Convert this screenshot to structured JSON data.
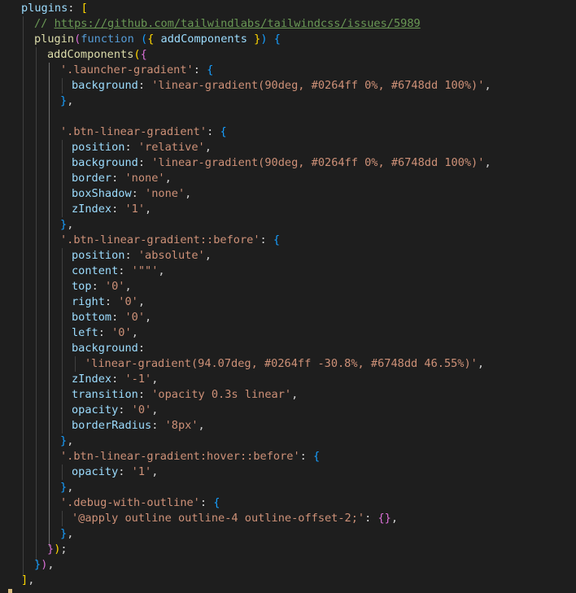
{
  "editor": {
    "theme": {
      "background": "#1e1e1e",
      "property": "#9cdcfe",
      "string": "#ce9178",
      "function": "#dcdcaa",
      "keyword": "#569cd6",
      "comment": "#6a9955",
      "punctuation": "#d4d4d4",
      "bracket_gold": "#ffd700",
      "bracket_purple": "#da70d6",
      "bracket_blue": "#179fff"
    },
    "lines": [
      [
        [
          "p",
          "plugins"
        ],
        [
          "d",
          ": "
        ],
        [
          "g",
          "["
        ]
      ],
      [
        [
          "c",
          "// "
        ],
        [
          "u",
          "https://github.com/tailwindlabs/tailwindcss/issues/5989"
        ]
      ],
      [
        [
          "f",
          "plugin"
        ],
        [
          "r",
          "("
        ],
        [
          "k",
          "function"
        ],
        [
          "d",
          " "
        ],
        [
          "b",
          "("
        ],
        [
          "g",
          "{"
        ],
        [
          "d",
          " "
        ],
        [
          "p",
          "addComponents"
        ],
        [
          "d",
          " "
        ],
        [
          "g",
          "}"
        ],
        [
          "b",
          ")"
        ],
        [
          "d",
          " "
        ],
        [
          "b",
          "{"
        ]
      ],
      [
        [
          "f",
          "addComponents"
        ],
        [
          "g",
          "("
        ],
        [
          "r",
          "{"
        ]
      ],
      [
        [
          "s",
          "'.launcher-gradient'"
        ],
        [
          "d",
          ": "
        ],
        [
          "b",
          "{"
        ]
      ],
      [
        [
          "p",
          "background"
        ],
        [
          "d",
          ": "
        ],
        [
          "s",
          "'linear-gradient(90deg, #0264ff 0%, #6748dd 100%)'"
        ],
        [
          "d",
          ","
        ]
      ],
      [
        [
          "b",
          "}"
        ],
        [
          "d",
          ","
        ]
      ],
      [],
      [
        [
          "s",
          "'.btn-linear-gradient'"
        ],
        [
          "d",
          ": "
        ],
        [
          "b",
          "{"
        ]
      ],
      [
        [
          "p",
          "position"
        ],
        [
          "d",
          ": "
        ],
        [
          "s",
          "'relative'"
        ],
        [
          "d",
          ","
        ]
      ],
      [
        [
          "p",
          "background"
        ],
        [
          "d",
          ": "
        ],
        [
          "s",
          "'linear-gradient(90deg, #0264ff 0%, #6748dd 100%)'"
        ],
        [
          "d",
          ","
        ]
      ],
      [
        [
          "p",
          "border"
        ],
        [
          "d",
          ": "
        ],
        [
          "s",
          "'none'"
        ],
        [
          "d",
          ","
        ]
      ],
      [
        [
          "p",
          "boxShadow"
        ],
        [
          "d",
          ": "
        ],
        [
          "s",
          "'none'"
        ],
        [
          "d",
          ","
        ]
      ],
      [
        [
          "p",
          "zIndex"
        ],
        [
          "d",
          ": "
        ],
        [
          "s",
          "'1'"
        ],
        [
          "d",
          ","
        ]
      ],
      [
        [
          "b",
          "}"
        ],
        [
          "d",
          ","
        ]
      ],
      [
        [
          "s",
          "'.btn-linear-gradient::before'"
        ],
        [
          "d",
          ": "
        ],
        [
          "b",
          "{"
        ]
      ],
      [
        [
          "p",
          "position"
        ],
        [
          "d",
          ": "
        ],
        [
          "s",
          "'absolute'"
        ],
        [
          "d",
          ","
        ]
      ],
      [
        [
          "p",
          "content"
        ],
        [
          "d",
          ": "
        ],
        [
          "s",
          "'\"\"'"
        ],
        [
          "d",
          ","
        ]
      ],
      [
        [
          "p",
          "top"
        ],
        [
          "d",
          ": "
        ],
        [
          "s",
          "'0'"
        ],
        [
          "d",
          ","
        ]
      ],
      [
        [
          "p",
          "right"
        ],
        [
          "d",
          ": "
        ],
        [
          "s",
          "'0'"
        ],
        [
          "d",
          ","
        ]
      ],
      [
        [
          "p",
          "bottom"
        ],
        [
          "d",
          ": "
        ],
        [
          "s",
          "'0'"
        ],
        [
          "d",
          ","
        ]
      ],
      [
        [
          "p",
          "left"
        ],
        [
          "d",
          ": "
        ],
        [
          "s",
          "'0'"
        ],
        [
          "d",
          ","
        ]
      ],
      [
        [
          "p",
          "background"
        ],
        [
          "d",
          ":"
        ]
      ],
      [
        [
          "s",
          "'linear-gradient(94.07deg, #0264ff -30.8%, #6748dd 46.55%)'"
        ],
        [
          "d",
          ","
        ]
      ],
      [
        [
          "p",
          "zIndex"
        ],
        [
          "d",
          ": "
        ],
        [
          "s",
          "'-1'"
        ],
        [
          "d",
          ","
        ]
      ],
      [
        [
          "p",
          "transition"
        ],
        [
          "d",
          ": "
        ],
        [
          "s",
          "'opacity 0.3s linear'"
        ],
        [
          "d",
          ","
        ]
      ],
      [
        [
          "p",
          "opacity"
        ],
        [
          "d",
          ": "
        ],
        [
          "s",
          "'0'"
        ],
        [
          "d",
          ","
        ]
      ],
      [
        [
          "p",
          "borderRadius"
        ],
        [
          "d",
          ": "
        ],
        [
          "s",
          "'8px'"
        ],
        [
          "d",
          ","
        ]
      ],
      [
        [
          "b",
          "}"
        ],
        [
          "d",
          ","
        ]
      ],
      [
        [
          "s",
          "'.btn-linear-gradient:hover::before'"
        ],
        [
          "d",
          ": "
        ],
        [
          "b",
          "{"
        ]
      ],
      [
        [
          "p",
          "opacity"
        ],
        [
          "d",
          ": "
        ],
        [
          "s",
          "'1'"
        ],
        [
          "d",
          ","
        ]
      ],
      [
        [
          "b",
          "}"
        ],
        [
          "d",
          ","
        ]
      ],
      [
        [
          "s",
          "'.debug-with-outline'"
        ],
        [
          "d",
          ": "
        ],
        [
          "b",
          "{"
        ]
      ],
      [
        [
          "s",
          "'@apply outline outline-4 outline-offset-2;'"
        ],
        [
          "d",
          ": "
        ],
        [
          "r",
          "{}"
        ],
        [
          "d",
          ","
        ]
      ],
      [
        [
          "b",
          "}"
        ],
        [
          "d",
          ","
        ]
      ],
      [
        [
          "r",
          "}"
        ],
        [
          "g",
          ")"
        ],
        [
          "d",
          ";"
        ]
      ],
      [
        [
          "b",
          "}"
        ],
        [
          "r",
          ")"
        ],
        [
          "d",
          ","
        ]
      ],
      [
        [
          "g",
          "]"
        ],
        [
          "d",
          ","
        ]
      ]
    ]
  }
}
